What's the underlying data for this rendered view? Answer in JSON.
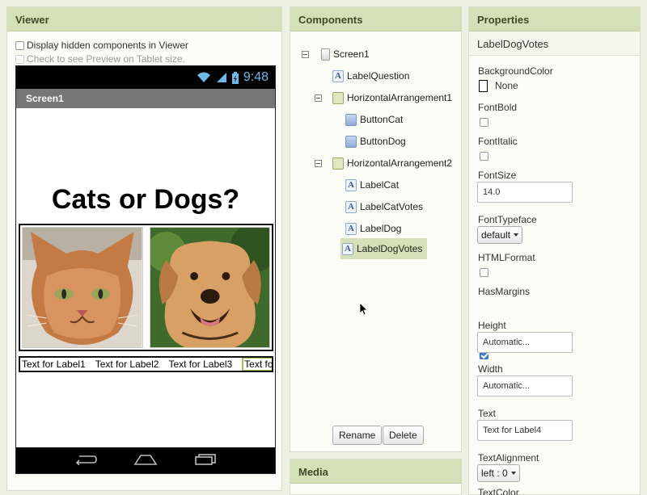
{
  "viewer": {
    "title": "Viewer",
    "display_hidden_label": "Display hidden components in Viewer",
    "tablet_preview_label": "Check to see Preview on Tablet size.",
    "phone": {
      "clock": "9:48",
      "screen_title": "Screen1",
      "heading": "Cats or Dogs?",
      "labels": [
        "Text for Label1",
        "Text for Label2",
        "Text for Label3",
        "Text for"
      ]
    }
  },
  "components": {
    "title": "Components",
    "tree": [
      {
        "name": "Screen1",
        "type": "screen"
      },
      {
        "name": "LabelQuestion",
        "type": "label"
      },
      {
        "name": "HorizontalArrangement1",
        "type": "harr"
      },
      {
        "name": "ButtonCat",
        "type": "button"
      },
      {
        "name": "ButtonDog",
        "type": "button"
      },
      {
        "name": "HorizontalArrangement2",
        "type": "harr"
      },
      {
        "name": "LabelCat",
        "type": "label"
      },
      {
        "name": "LabelCatVotes",
        "type": "label"
      },
      {
        "name": "LabelDog",
        "type": "label"
      },
      {
        "name": "LabelDogVotes",
        "type": "label"
      }
    ],
    "rename_label": "Rename",
    "delete_label": "Delete"
  },
  "media": {
    "title": "Media"
  },
  "properties": {
    "title": "Properties",
    "selected_component": "LabelDogVotes",
    "background_color": {
      "label": "BackgroundColor",
      "value": "None"
    },
    "font_bold": {
      "label": "FontBold",
      "checked": false
    },
    "font_italic": {
      "label": "FontItalic",
      "checked": false
    },
    "font_size": {
      "label": "FontSize",
      "value": "14.0"
    },
    "font_typeface": {
      "label": "FontTypeface",
      "value": "default"
    },
    "html_format": {
      "label": "HTMLFormat",
      "checked": false
    },
    "has_margins": {
      "label": "HasMargins",
      "checked": true
    },
    "height": {
      "label": "Height",
      "value": "Automatic..."
    },
    "width": {
      "label": "Width",
      "value": "Automatic..."
    },
    "text": {
      "label": "Text",
      "value": "Text for Label4"
    },
    "text_alignment": {
      "label": "TextAlignment",
      "value": "left : 0"
    },
    "text_color": {
      "label": "TextColor"
    }
  },
  "colors": {
    "header_bg": "#d5e0b8",
    "selected_bg": "#d5e0b8",
    "status_icon": "#6cb9ea",
    "checkbox_checked": "#3a82d6"
  }
}
